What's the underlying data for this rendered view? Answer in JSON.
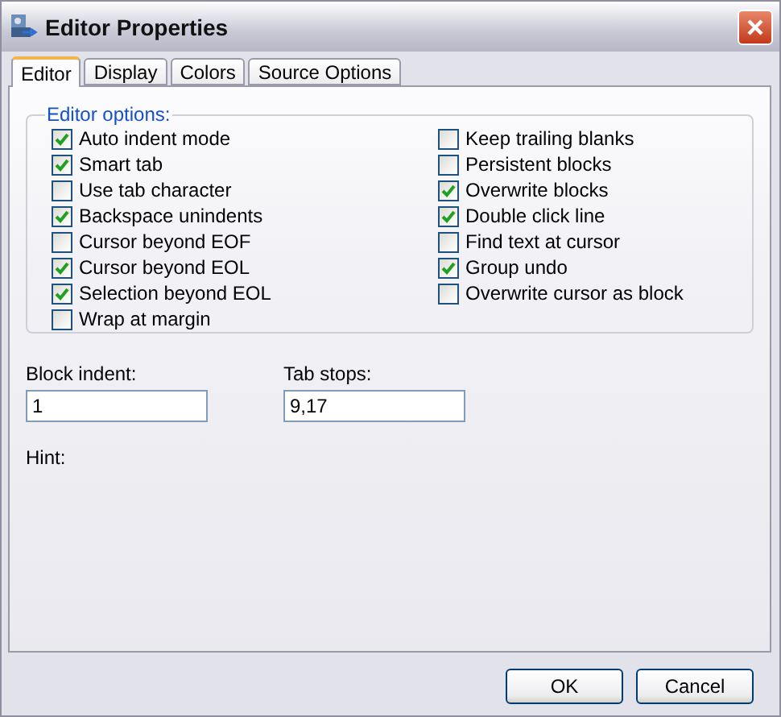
{
  "window": {
    "title": "Editor Properties"
  },
  "tabs": [
    {
      "label": "Editor",
      "selected": true
    },
    {
      "label": "Display",
      "selected": false
    },
    {
      "label": "Colors",
      "selected": false
    },
    {
      "label": "Source Options",
      "selected": false
    }
  ],
  "group": {
    "title": "Editor options:",
    "left": [
      {
        "label": "Auto indent mode",
        "checked": true
      },
      {
        "label": "Smart tab",
        "checked": true
      },
      {
        "label": "Use tab character",
        "checked": false
      },
      {
        "label": "Backspace unindents",
        "checked": true
      },
      {
        "label": "Cursor beyond EOF",
        "checked": false
      },
      {
        "label": "Cursor beyond EOL",
        "checked": true
      },
      {
        "label": "Selection beyond EOL",
        "checked": true
      },
      {
        "label": "Wrap at margin",
        "checked": false
      }
    ],
    "right": [
      {
        "label": "Keep trailing blanks",
        "checked": false
      },
      {
        "label": "Persistent blocks",
        "checked": false
      },
      {
        "label": "Overwrite blocks",
        "checked": true
      },
      {
        "label": "Double click line",
        "checked": true
      },
      {
        "label": "Find text at cursor",
        "checked": false
      },
      {
        "label": "Group undo",
        "checked": true
      },
      {
        "label": "Overwrite cursor as block",
        "checked": false
      }
    ]
  },
  "fields": [
    {
      "label": "Block indent:",
      "value": "1"
    },
    {
      "label": "Tab stops:",
      "value": "9,17"
    }
  ],
  "hint": {
    "label": "Hint:"
  },
  "buttons": [
    "OK",
    "Cancel"
  ]
}
